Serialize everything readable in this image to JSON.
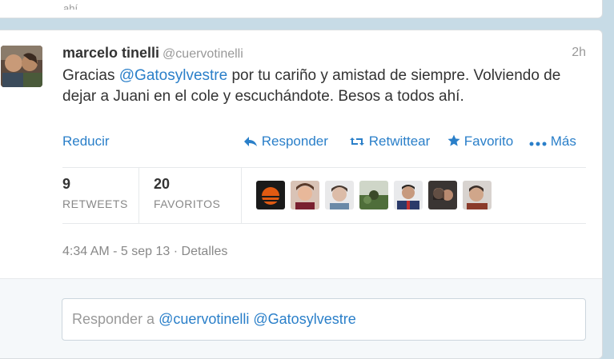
{
  "tweet": {
    "name": "marcelo tinelli",
    "handle": "@cuervotinelli",
    "time": "2h",
    "text_prefix": "Gracias ",
    "text_mention": "@Gatosylvestre",
    "text_suffix": " por tu cariño y amistad de siempre. Volviendo de dejar a Juani en el cole y escuchándote. Besos a todos ahí."
  },
  "actions": {
    "collapse": "Reducir",
    "reply": "Responder",
    "retweet": "Retwittear",
    "favorite": "Favorito",
    "more": "Más"
  },
  "stats": {
    "retweets_count": "9",
    "retweets_label": "RETWEETS",
    "favorites_count": "20",
    "favorites_label": "FAVORITOS"
  },
  "meta": {
    "timestamp": "4:34 AM - 5 sep 13",
    "separator": " · ",
    "details": "Detalles"
  },
  "reply": {
    "prefix": "Responder a ",
    "mentions": "@cuervotinelli @Gatosylvestre"
  },
  "colors": {
    "link": "#2a7fc9",
    "text": "#333333",
    "muted": "#999999",
    "page_bg": "#c7dbe6"
  }
}
